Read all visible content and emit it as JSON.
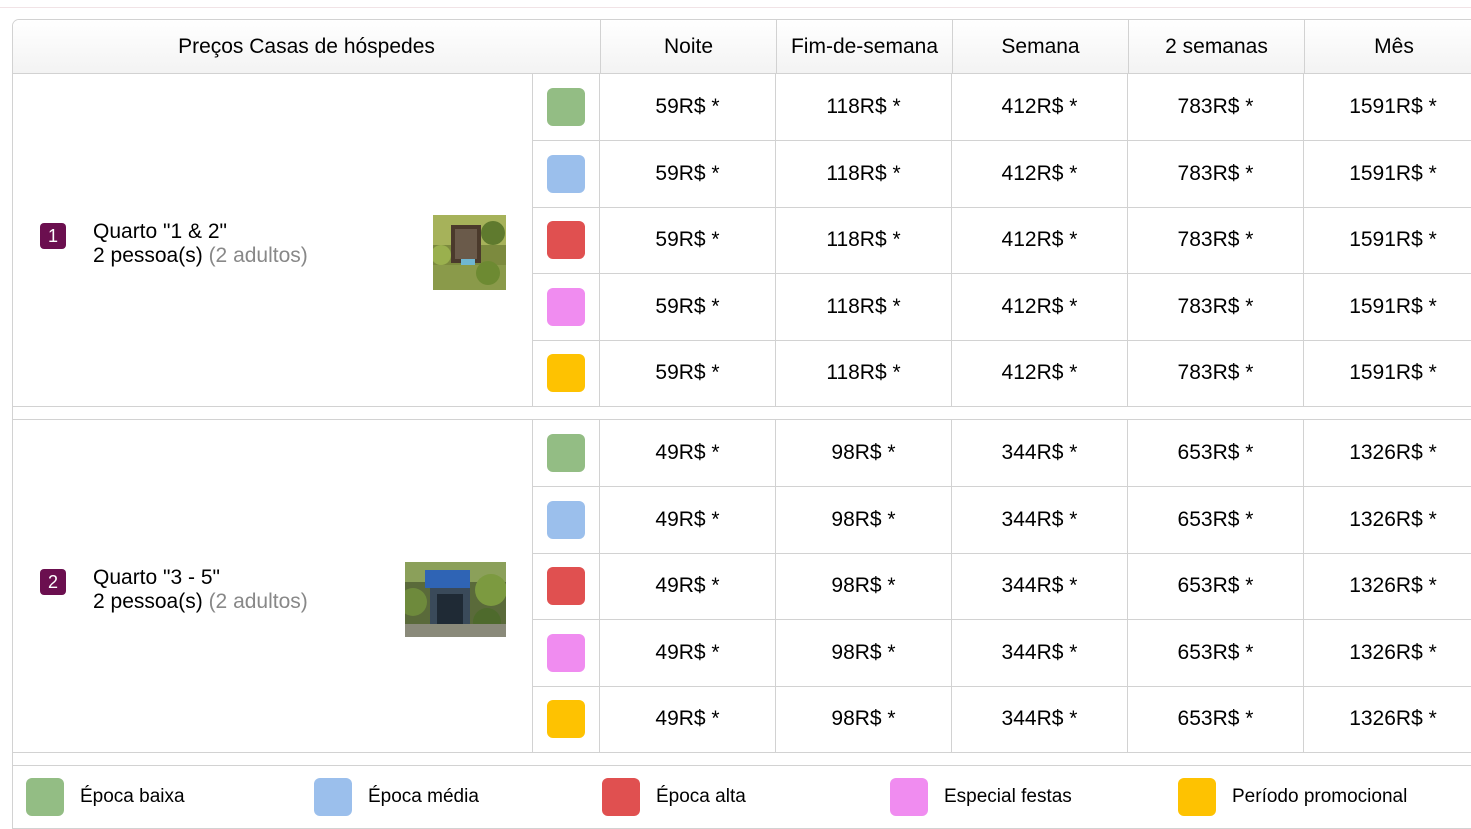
{
  "colors": {
    "baixa": "#93bd84",
    "media": "#9bbfec",
    "alta": "#e05050",
    "festas": "#f08cf0",
    "promo": "#fec201",
    "room_badge": "#6b0f4f"
  },
  "header": {
    "title": "Preços Casas de hóspedes",
    "columns": [
      "Noite",
      "Fim-de-semana",
      "Semana",
      "2 semanas",
      "Mês"
    ]
  },
  "rooms": [
    {
      "number": "1",
      "name": "Quarto \"1 & 2\"",
      "people": "2 pessoa(s)",
      "detail": "(2 adultos)",
      "rows": [
        {
          "season": "baixa",
          "prices": [
            "59R$ *",
            "118R$ *",
            "412R$ *",
            "783R$ *",
            "1591R$ *"
          ]
        },
        {
          "season": "media",
          "prices": [
            "59R$ *",
            "118R$ *",
            "412R$ *",
            "783R$ *",
            "1591R$ *"
          ]
        },
        {
          "season": "alta",
          "prices": [
            "59R$ *",
            "118R$ *",
            "412R$ *",
            "783R$ *",
            "1591R$ *"
          ]
        },
        {
          "season": "festas",
          "prices": [
            "59R$ *",
            "118R$ *",
            "412R$ *",
            "783R$ *",
            "1591R$ *"
          ]
        },
        {
          "season": "promo",
          "prices": [
            "59R$ *",
            "118R$ *",
            "412R$ *",
            "783R$ *",
            "1591R$ *"
          ]
        }
      ]
    },
    {
      "number": "2",
      "name": "Quarto \"3 - 5\"",
      "people": "2 pessoa(s)",
      "detail": "(2 adultos)",
      "rows": [
        {
          "season": "baixa",
          "prices": [
            "49R$ *",
            "98R$ *",
            "344R$ *",
            "653R$ *",
            "1326R$ *"
          ]
        },
        {
          "season": "media",
          "prices": [
            "49R$ *",
            "98R$ *",
            "344R$ *",
            "653R$ *",
            "1326R$ *"
          ]
        },
        {
          "season": "alta",
          "prices": [
            "49R$ *",
            "98R$ *",
            "344R$ *",
            "653R$ *",
            "1326R$ *"
          ]
        },
        {
          "season": "festas",
          "prices": [
            "49R$ *",
            "98R$ *",
            "344R$ *",
            "653R$ *",
            "1326R$ *"
          ]
        },
        {
          "season": "promo",
          "prices": [
            "49R$ *",
            "98R$ *",
            "344R$ *",
            "653R$ *",
            "1326R$ *"
          ]
        }
      ]
    }
  ],
  "legend": [
    {
      "season": "baixa",
      "label": "Época baixa"
    },
    {
      "season": "media",
      "label": "Época média"
    },
    {
      "season": "alta",
      "label": "Época alta"
    },
    {
      "season": "festas",
      "label": "Especial festas"
    },
    {
      "season": "promo",
      "label": "Período promocional"
    }
  ]
}
